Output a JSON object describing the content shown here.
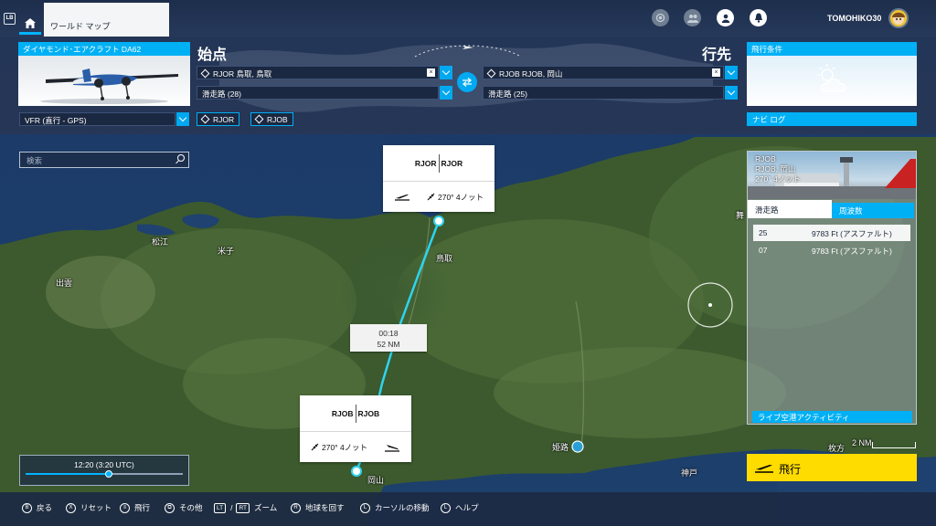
{
  "topbar": {
    "lb_label": "LB",
    "tab_label": "ワールド マップ",
    "username": "TOMOHIKO30"
  },
  "aircraft": {
    "title": "ダイヤモンド･エアクラフト DA62"
  },
  "departure": {
    "heading": "始点",
    "airport": "RJOR 鳥取, 鳥取",
    "runway": "滑走路 (28)"
  },
  "arrival": {
    "heading": "行先",
    "airport": "RJOB RJOB, 岡山",
    "runway": "滑走路 (25)"
  },
  "conditions": {
    "title": "飛行条件"
  },
  "flight_type": "VFR (直行 - GPS)",
  "route_buttons": [
    "RJOR",
    "RJOB"
  ],
  "navlog_label": "ナビ ログ",
  "search_placeholder": "検索",
  "dep_card": {
    "from": "RJOR",
    "to": "RJOR",
    "wind": "270° 4ノット"
  },
  "arr_card": {
    "from": "RJOB",
    "to": "RJOB",
    "wind": "270° 4ノット"
  },
  "leg": {
    "time": "00:18",
    "distance": "52 NM"
  },
  "map_labels": {
    "matsue": "松江",
    "yonago": "米子",
    "izumo": "出雲",
    "tottori": "鳥取",
    "himeji": "姫路",
    "kobe": "神戸",
    "okayama": "岡山",
    "maizuru": "舞",
    "hirakata": "枚方",
    "scale": "2 NM"
  },
  "airport_panel": {
    "line1": "RJOB",
    "line2": "RJOB, 岡山",
    "line3": "270° 4ノット",
    "tab_runways": "滑走路",
    "tab_freq": "周波数",
    "runways": [
      {
        "id": "25",
        "length": "9783 Ft (アスファルト)"
      },
      {
        "id": "07",
        "length": "9783 Ft (アスファルト)"
      }
    ],
    "live_activity": "ライブ空港アクティビティ"
  },
  "fly_button": "飛行",
  "timeline": {
    "label": "12:20 (3:20 UTC)",
    "progress": 0.53
  },
  "bottombar": [
    {
      "key": "B",
      "label": "戻る"
    },
    {
      "key": "X",
      "label": "リセット"
    },
    {
      "key": "≡",
      "label": "飛行"
    },
    {
      "key": "⧉",
      "label": "その他"
    },
    {
      "key": "LT",
      "key2": "RT",
      "label": "ズーム"
    },
    {
      "key": "R",
      "label": "地球を回す"
    },
    {
      "key": "L",
      "label": "カーソルの移動"
    },
    {
      "key": "L",
      "label": "ヘルプ"
    }
  ],
  "colors": {
    "accent": "#00b0f5",
    "route": "#2ed3ef",
    "fly": "#ffdc00"
  }
}
